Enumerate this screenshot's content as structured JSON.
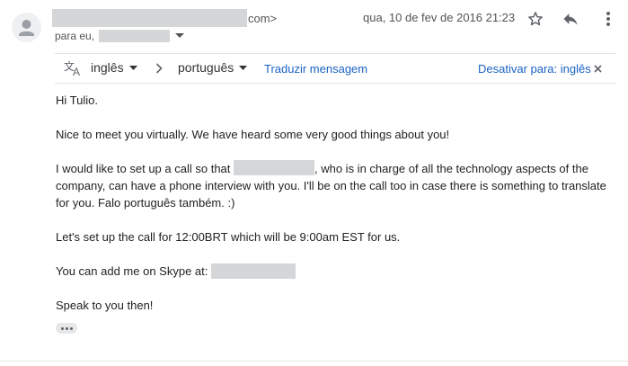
{
  "header": {
    "sender_suffix": "com>",
    "date": "qua, 10 de fev de 2016 21:23",
    "to_label": "para eu,"
  },
  "translate": {
    "source_lang": "inglês",
    "target_lang": "português",
    "translate_link": "Traduzir mensagem",
    "disable_link": "Desativar para: inglês"
  },
  "message": {
    "greeting": "Hi Tulio.",
    "meet": "Nice to meet you virtually.  We have heard some very good things about you!",
    "call_before": "I would like to set up a call so that ",
    "call_after": ", who is in charge of all the technology aspects of the company, can have a phone interview with you.  I'll be on the call too in case there is something to translate for you.  Falo português também.  :)",
    "time": "Let's set up the call for 12:00BRT which will be 9:00am EST for us.",
    "skype_label": "You can add me on Skype at:",
    "closing": "Speak to you then!"
  },
  "icons": {
    "avatar": "person-icon",
    "star": "star-outline-icon",
    "reply": "reply-icon",
    "more": "more-vert-icon",
    "translate": "translate-icon",
    "close": "close-icon",
    "caret": "caret-down-icon",
    "arrow": "chevron-right-icon"
  },
  "colors": {
    "link": "#1a62c4",
    "redaction": "#d4d6d8"
  }
}
